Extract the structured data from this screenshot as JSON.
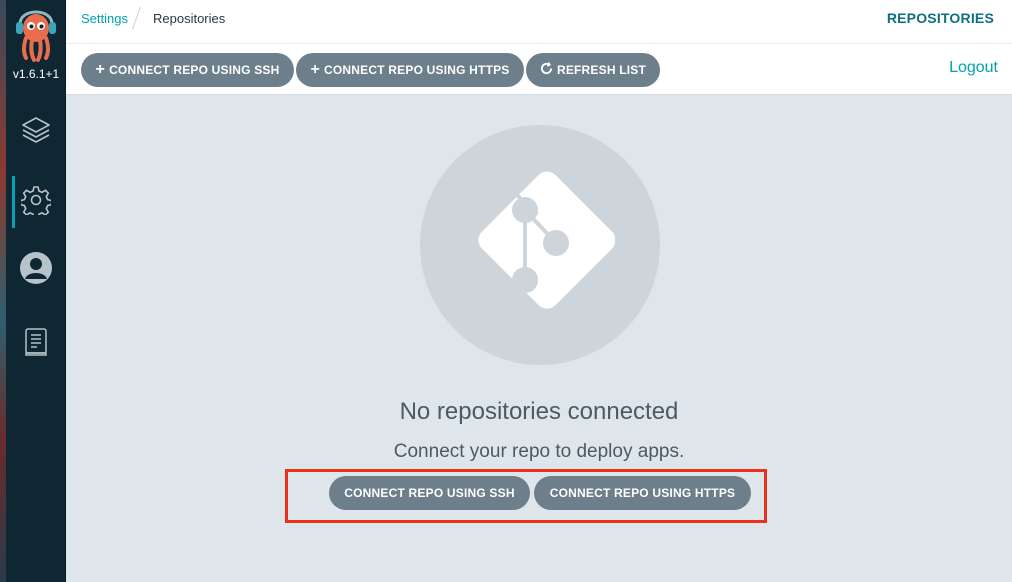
{
  "app": {
    "version": "v1.6.1+1"
  },
  "sidebar": {
    "items": [
      {
        "icon": "layers-icon",
        "active": false
      },
      {
        "icon": "gear-icon",
        "active": true
      },
      {
        "icon": "user-icon",
        "active": false
      },
      {
        "icon": "docs-icon",
        "active": false
      }
    ]
  },
  "breadcrumb": {
    "parent": "Settings",
    "current": "Repositories"
  },
  "header": {
    "title": "REPOSITORIES"
  },
  "toolbar": {
    "connect_ssh_label": "CONNECT REPO USING SSH",
    "connect_https_label": "CONNECT REPO USING HTTPS",
    "refresh_label": "REFRESH LIST",
    "logout_label": "Logout"
  },
  "empty_state": {
    "title": "No repositories connected",
    "subtitle": "Connect your repo to deploy apps.",
    "connect_ssh_label": "CONNECT REPO USING SSH",
    "connect_https_label": "CONNECT REPO USING HTTPS",
    "icon": "git-icon"
  },
  "colors": {
    "accent": "#00a2b3",
    "sidebar_bg": "#0f2733",
    "button_bg": "#6d7f8b",
    "highlight": "#e8321e"
  }
}
